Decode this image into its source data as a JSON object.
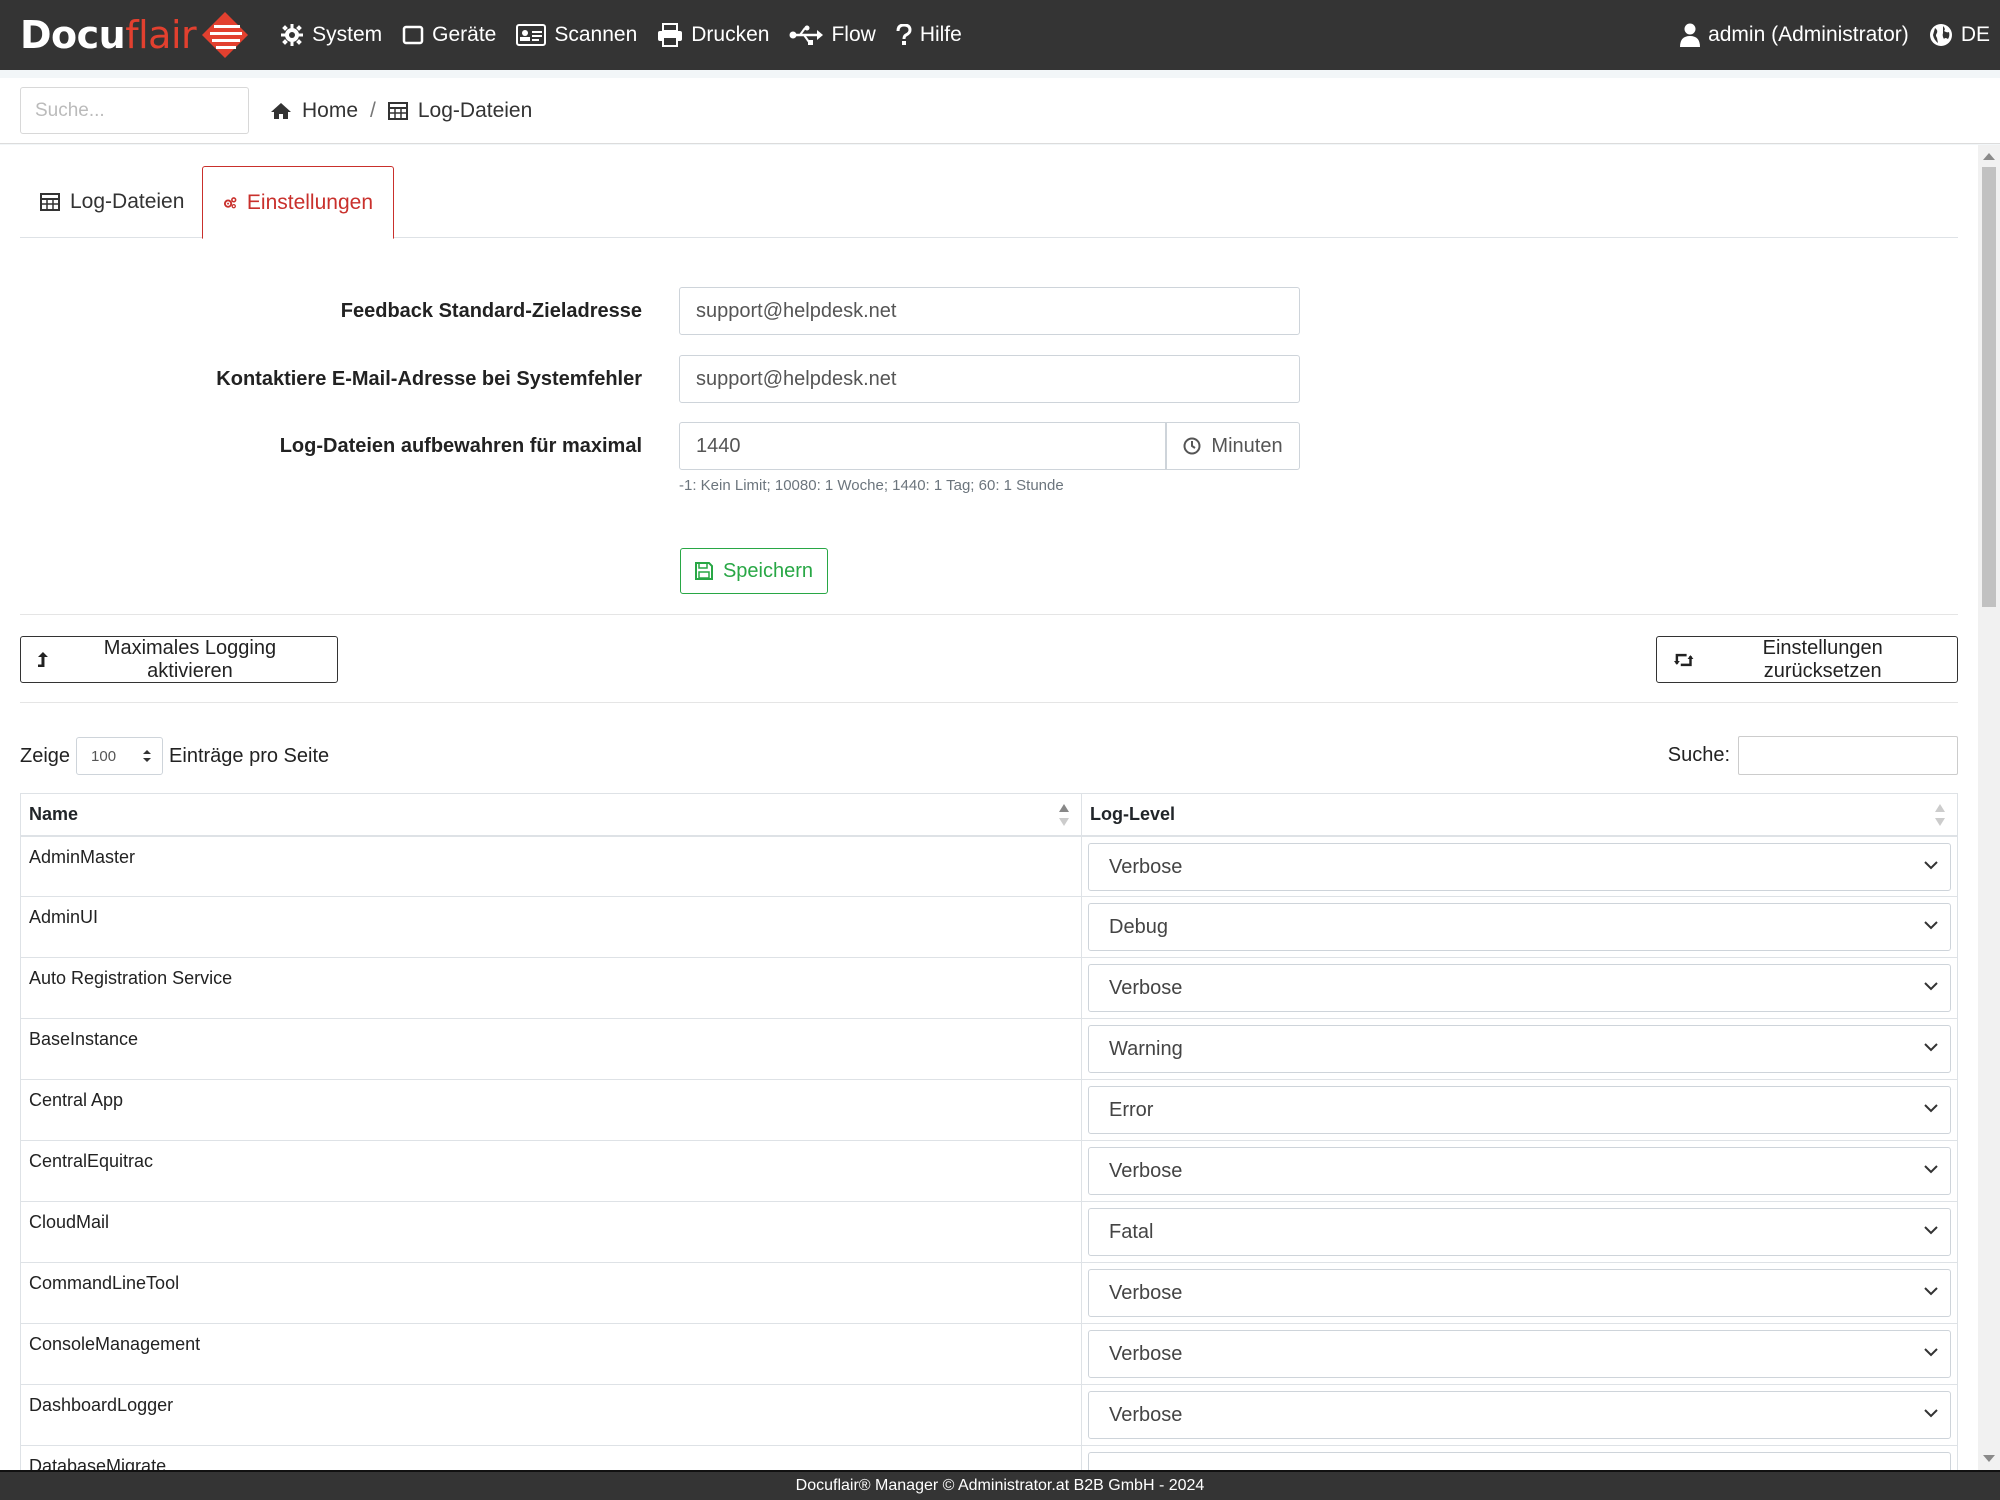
{
  "navbar": {
    "brand_part1": "Docu",
    "brand_part2": "flair",
    "items": [
      {
        "label": "System",
        "icon": "gear-icon"
      },
      {
        "label": "Geräte",
        "icon": "device-icon"
      },
      {
        "label": "Scannen",
        "icon": "id-card-icon"
      },
      {
        "label": "Drucken",
        "icon": "printer-icon"
      },
      {
        "label": "Flow",
        "icon": "usb-flow-icon"
      },
      {
        "label": "Hilfe",
        "icon": "question-icon"
      }
    ],
    "user": "admin (Administrator)",
    "language": "DE"
  },
  "subheader": {
    "search_placeholder": "Suche...",
    "breadcrumb_home": "Home",
    "breadcrumb_current": "Log-Dateien"
  },
  "tabs": {
    "log_files": "Log-Dateien",
    "settings": "Einstellungen",
    "active": "Einstellungen"
  },
  "form": {
    "feedback_label": "Feedback Standard-Zieladresse",
    "feedback_value": "support@helpdesk.net",
    "contact_label": "Kontaktiere E-Mail-Adresse bei Systemfehler",
    "contact_value": "support@helpdesk.net",
    "retention_label": "Log-Dateien aufbewahren für maximal",
    "retention_value": "1440",
    "retention_unit": "Minuten",
    "retention_help": "-1: Kein Limit; 10080: 1 Woche; 1440: 1 Tag; 60: 1 Stunde",
    "save_label": "Speichern"
  },
  "actions": {
    "max_logging": "Maximales Logging aktivieren",
    "reset_settings": "Einstellungen zurücksetzen"
  },
  "table": {
    "show_label": "Zeige",
    "page_length": "100",
    "entries_label": "Einträge pro Seite",
    "search_label": "Suche:",
    "columns": [
      "Name",
      "Log-Level"
    ],
    "rows": [
      {
        "name": "AdminMaster",
        "level": "Verbose"
      },
      {
        "name": "AdminUI",
        "level": "Debug"
      },
      {
        "name": "Auto Registration Service",
        "level": "Verbose"
      },
      {
        "name": "BaseInstance",
        "level": "Warning"
      },
      {
        "name": "Central App",
        "level": "Error"
      },
      {
        "name": "CentralEquitrac",
        "level": "Verbose"
      },
      {
        "name": "CloudMail",
        "level": "Fatal"
      },
      {
        "name": "CommandLineTool",
        "level": "Verbose"
      },
      {
        "name": "ConsoleManagement",
        "level": "Verbose"
      },
      {
        "name": "DashboardLogger",
        "level": "Verbose"
      },
      {
        "name": "DatabaseMigrate",
        "level": ""
      }
    ]
  },
  "footer": "Docuflair® Manager © Administrator.at B2B GmbH - 2024",
  "colors": {
    "navbar_bg": "#343434",
    "brand_red": "#e2402f",
    "active_tab": "#c9302c",
    "save_green": "#28a745"
  }
}
